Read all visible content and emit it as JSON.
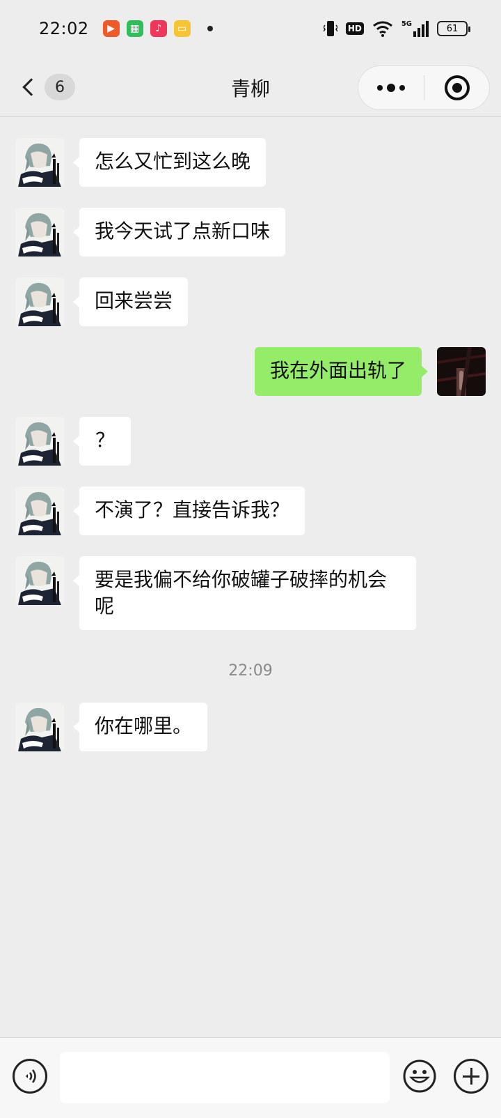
{
  "status_bar": {
    "time": "22:02",
    "network": "5G",
    "battery": "61",
    "hd_label": "HD",
    "app_icons": [
      "video-app-icon",
      "calculator-app-icon",
      "music-app-icon",
      "notes-app-icon"
    ]
  },
  "header": {
    "back_count": "6",
    "title": "青柳"
  },
  "messages": [
    {
      "side": "left",
      "text": "怎么又忙到这么晚"
    },
    {
      "side": "left",
      "text": "我今天试了点新口味"
    },
    {
      "side": "left",
      "text": "回来尝尝"
    },
    {
      "side": "right",
      "text": "我在外面出轨了"
    },
    {
      "side": "left",
      "text": "？"
    },
    {
      "side": "left",
      "text": "不演了？直接告诉我？"
    },
    {
      "side": "left",
      "text": "要是我偏不给你破罐子破摔的机会呢"
    },
    {
      "side": "left",
      "text": "你在哪里。"
    }
  ],
  "timestamp": "22:09",
  "input": {
    "placeholder": ""
  },
  "colors": {
    "background": "#ededed",
    "bubble_left": "#ffffff",
    "bubble_right": "#95ec69"
  }
}
